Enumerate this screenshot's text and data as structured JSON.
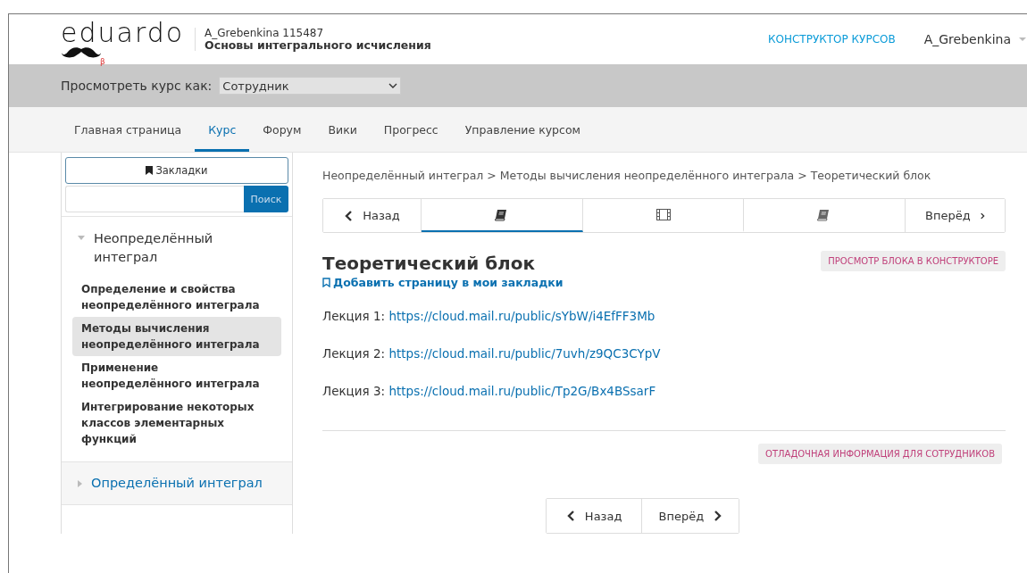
{
  "header": {
    "logo": "eduardo",
    "logo_badge": "β",
    "course_code": "A_Grebenkina 115487",
    "course_title": "Основы интегрального исчисления",
    "studio_link": "КОНСТРУКТОР КУРСОВ",
    "username": "A_Grebenkina"
  },
  "view_as": {
    "label": "Просмотреть курс как:",
    "value": "Сотрудник"
  },
  "tabs": [
    {
      "label": "Главная страница",
      "selected": false
    },
    {
      "label": "Курс",
      "selected": true
    },
    {
      "label": "Форум",
      "selected": false
    },
    {
      "label": "Вики",
      "selected": false
    },
    {
      "label": "Прогресс",
      "selected": false
    },
    {
      "label": "Управление курсом",
      "selected": false
    }
  ],
  "sidebar": {
    "bookmarks_button": "Закладки",
    "search_button": "Поиск",
    "chapters": [
      {
        "title": "Неопределённый интеграл",
        "expanded": true,
        "children": [
          {
            "title": "Определение и свойства неопределённого интеграла",
            "selected": false
          },
          {
            "title": "Методы вычисления неопределённого интеграла",
            "selected": true
          },
          {
            "title": "Применение неопределённого интеграла",
            "selected": false
          },
          {
            "title": "Интегрирование некоторых классов элементарных функций",
            "selected": false
          }
        ]
      },
      {
        "title": "Определённый интеграл",
        "expanded": false
      }
    ]
  },
  "breadcrumb": "Неопределённый интеграл > Методы вычисления неопределённого интеграла > Теоретический блок",
  "sequence": {
    "prev": "Назад",
    "next": "Вперёд",
    "units": [
      {
        "kind": "text",
        "selected": true
      },
      {
        "kind": "video",
        "selected": false
      },
      {
        "kind": "text",
        "selected": false
      }
    ]
  },
  "unit": {
    "title": "Теоретический блок",
    "studio_button": "ПРОСМОТР БЛОКА В КОНСТРУКТОРЕ",
    "bookmark_link": "Добавить страницу в мои закладки",
    "lectures": [
      {
        "label": "Лекция 1:",
        "link": "https://cloud.mail.ru/public/sYbW/i4EfFF3Mb"
      },
      {
        "label": "Лекция 2:",
        "link": "https://cloud.mail.ru/public/7uvh/z9QC3CYpV"
      },
      {
        "label": "Лекция 3:",
        "link": "https://cloud.mail.ru/public/Tp2G/Bx4BSsarF"
      }
    ],
    "debug_button": "ОТЛАДОЧНАЯ ИНФОРМАЦИЯ ДЛЯ СОТРУДНИКОВ"
  },
  "bottom_nav": {
    "prev": "Назад",
    "next": "Вперёд"
  }
}
